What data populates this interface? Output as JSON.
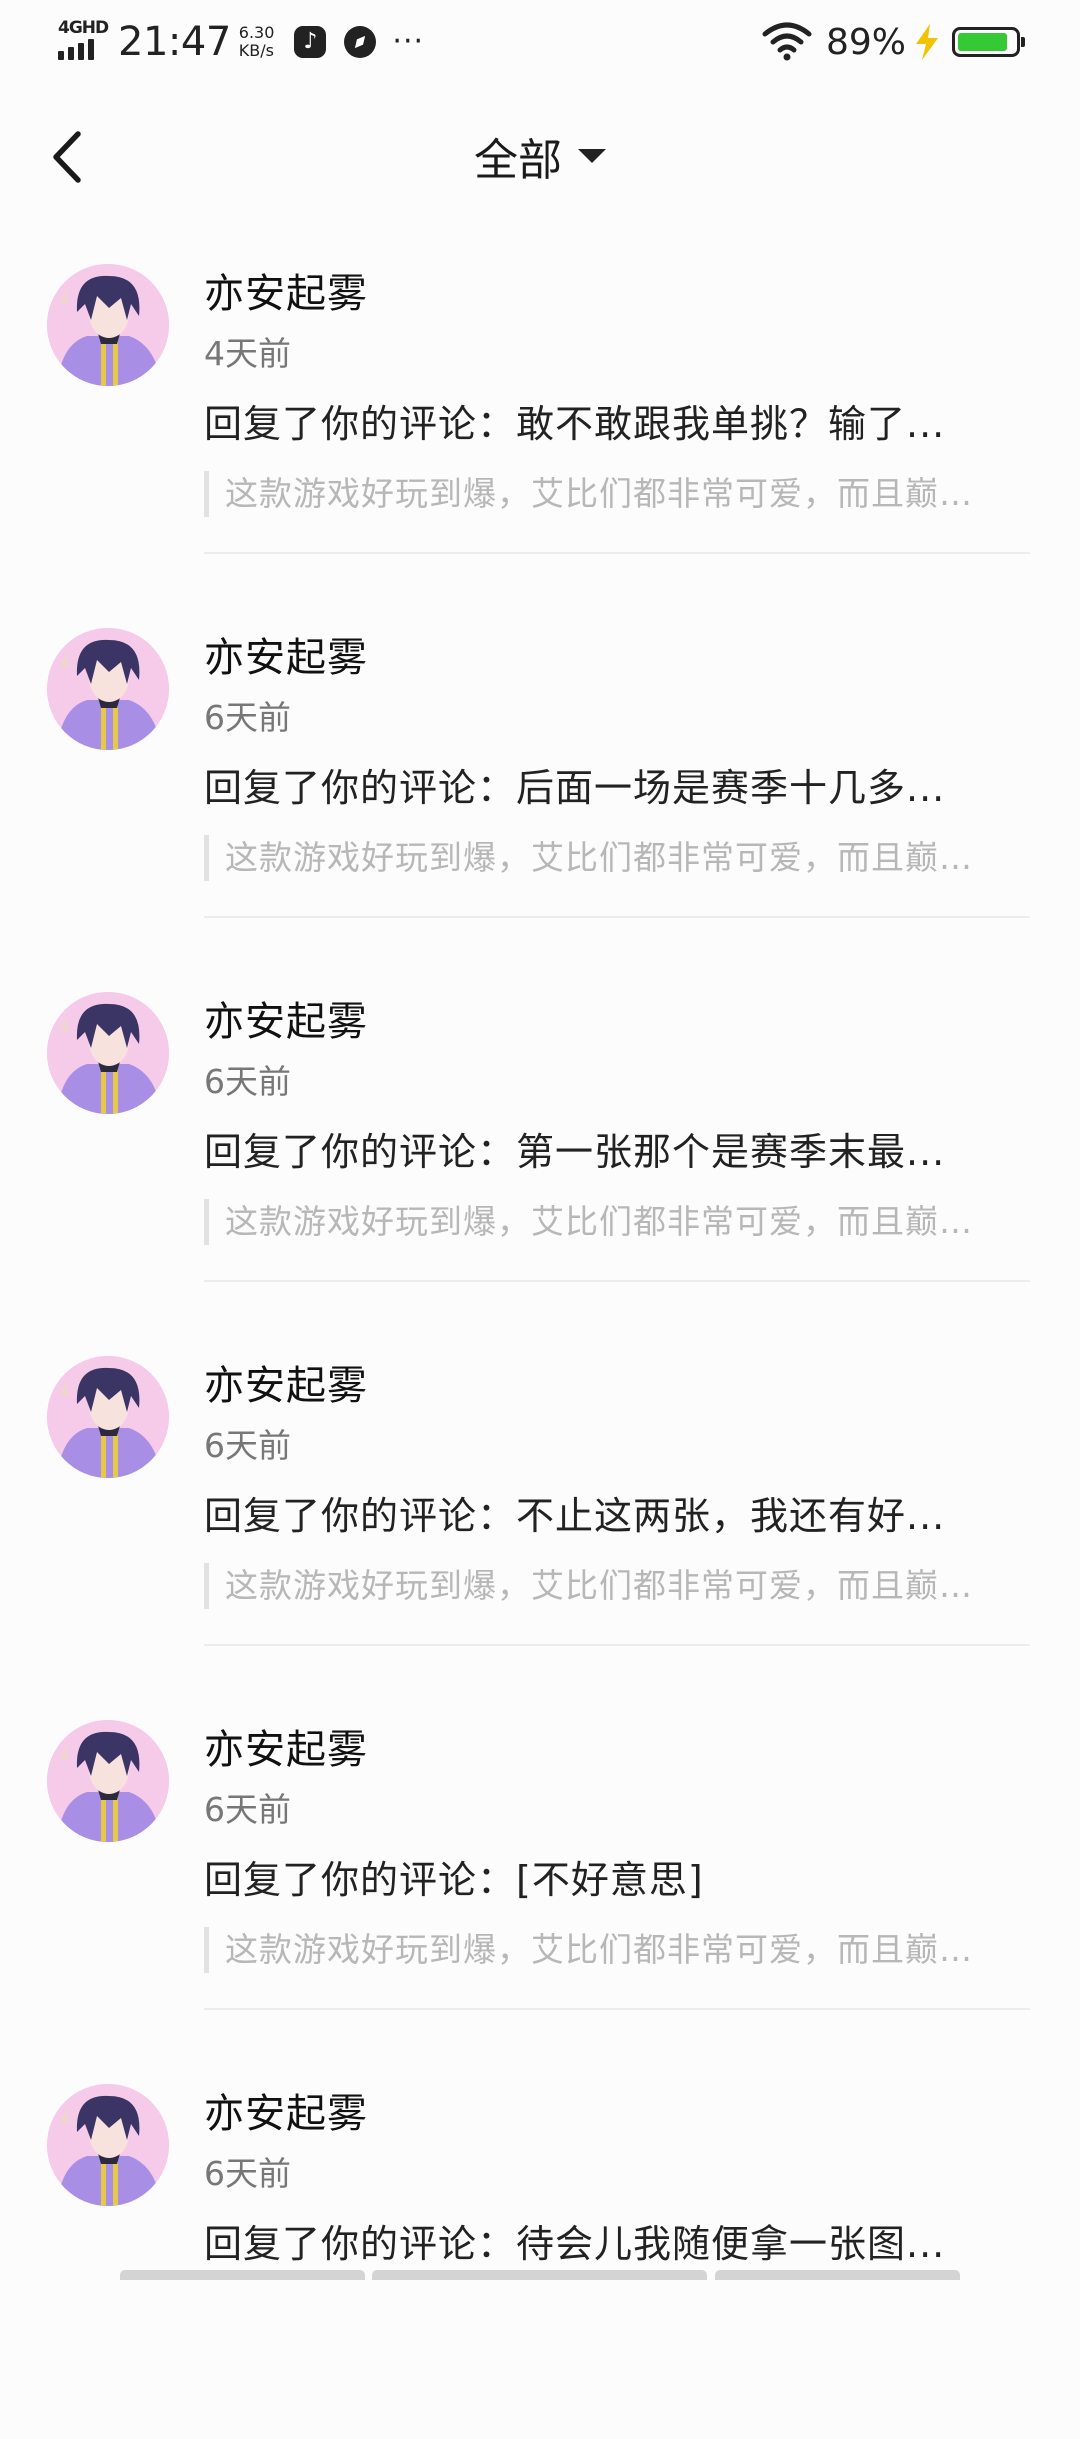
{
  "status_bar": {
    "network": "4GHD",
    "time": "21:47",
    "speed_value": "6.30",
    "speed_unit": "KB/s",
    "more": "···",
    "battery_percent": "89%",
    "battery_level": 0.89,
    "icons": [
      "signal-icon",
      "tiktok-icon",
      "compass-icon",
      "wifi-icon",
      "charging-bolt-icon",
      "battery-icon"
    ]
  },
  "header": {
    "title": "全部",
    "back_icon": "chevron-left-icon",
    "filter_icon": "caret-down-icon"
  },
  "notifications": [
    {
      "name": "亦安起雾",
      "time": "4天前",
      "reply": "回复了你的评论：敢不敢跟我单挑？输了...",
      "quote": "这款游戏好玩到爆，艾比们都非常可爱，而且巅…"
    },
    {
      "name": "亦安起雾",
      "time": "6天前",
      "reply": "回复了你的评论：后面一场是赛季十几多...",
      "quote": "这款游戏好玩到爆，艾比们都非常可爱，而且巅…"
    },
    {
      "name": "亦安起雾",
      "time": "6天前",
      "reply": "回复了你的评论：第一张那个是赛季末最...",
      "quote": "这款游戏好玩到爆，艾比们都非常可爱，而且巅…"
    },
    {
      "name": "亦安起雾",
      "time": "6天前",
      "reply": "回复了你的评论：不止这两张，我还有好...",
      "quote": "这款游戏好玩到爆，艾比们都非常可爱，而且巅…"
    },
    {
      "name": "亦安起雾",
      "time": "6天前",
      "reply": "回复了你的评论：[不好意思]",
      "quote": "这款游戏好玩到爆，艾比们都非常可爱，而且巅…"
    },
    {
      "name": "亦安起雾",
      "time": "6天前",
      "reply": "回复了你的评论：待会儿我随便拿一张图...",
      "quote": ""
    }
  ],
  "colors": {
    "background": "#fdfcfd",
    "divider": "#ececec",
    "muted_text": "#777777",
    "quote_text": "#b7b7b7",
    "battery_fill": "#34c935"
  }
}
